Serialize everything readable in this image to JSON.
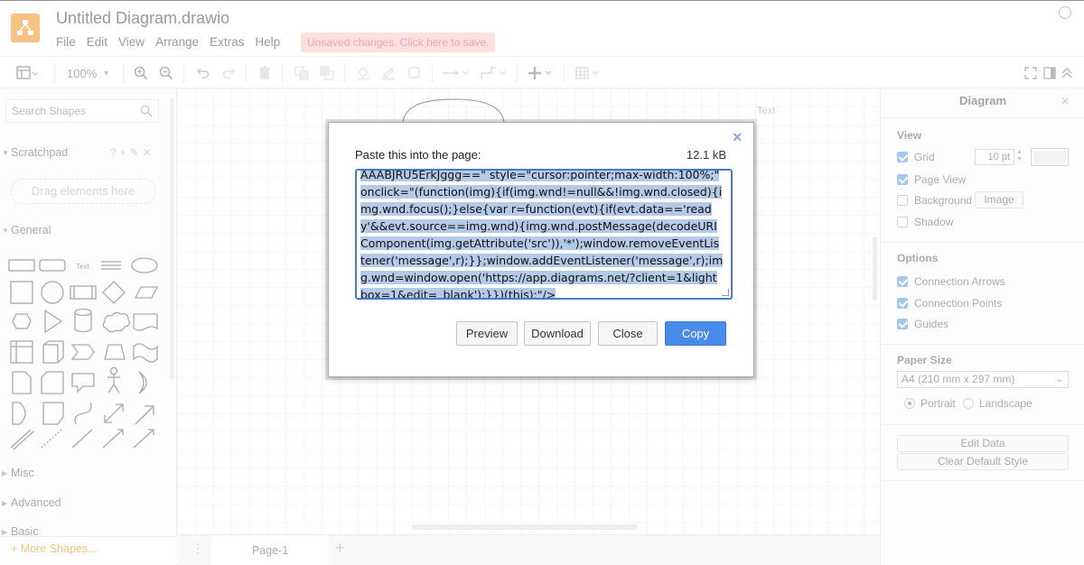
{
  "app": {
    "title": "Untitled Diagram.drawio",
    "menu": [
      "File",
      "Edit",
      "View",
      "Arrange",
      "Extras",
      "Help"
    ],
    "unsaved_notice": "Unsaved changes. Click here to save.",
    "brand_color": "#f08705"
  },
  "toolbar": {
    "zoom": "100%"
  },
  "sidebar": {
    "search_placeholder": "Search Shapes",
    "scratchpad_label": "Scratchpad",
    "scratchpad_icons": "?+✎✕",
    "drag_hint": "Drag elements here",
    "general_label": "General",
    "text_shape_label": "Text",
    "misc_label": "Misc",
    "advanced_label": "Advanced",
    "basic_label": "Basic",
    "more_shapes": "+ More Shapes..."
  },
  "canvas": {
    "text_label": "Text",
    "page_tab": "Page-1"
  },
  "panel": {
    "title": "Diagram",
    "view_heading": "View",
    "grid_label": "Grid",
    "grid_size": "10 pt",
    "page_view_label": "Page View",
    "background_label": "Background",
    "image_button": "Image",
    "shadow_label": "Shadow",
    "options_heading": "Options",
    "connection_arrows": "Connection Arrows",
    "connection_points": "Connection Points",
    "guides": "Guides",
    "paper_size_heading": "Paper Size",
    "paper_size_value": "A4 (210 mm x 297 mm)",
    "portrait": "Portrait",
    "landscape": "Landscape",
    "edit_data": "Edit Data",
    "clear_default_style": "Clear Default Style"
  },
  "dialog": {
    "label": "Paste this into the page:",
    "size": "12.1 kB",
    "code_text": "AAABJRU5ErkJggg==\" style=\"cursor:pointer;max-width:100%;\" onclick=\"(function(img){if(img.wnd!=null&&!img.wnd.closed){img.wnd.focus();}else{var r=function(evt){if(evt.data=='ready'&&evt.source==img.wnd){img.wnd.postMessage(decodeURIComponent(img.getAttribute('src')),'*');window.removeEventListener('message',r);}};window.addEventListener('message',r);img.wnd=window.open('https://app.diagrams.net/?client=1&lightbox=1&edit=_blank');}})(this);\"/>",
    "buttons": {
      "preview": "Preview",
      "download": "Download",
      "close": "Close",
      "copy": "Copy"
    },
    "copy_color": "#4a8ae8"
  }
}
